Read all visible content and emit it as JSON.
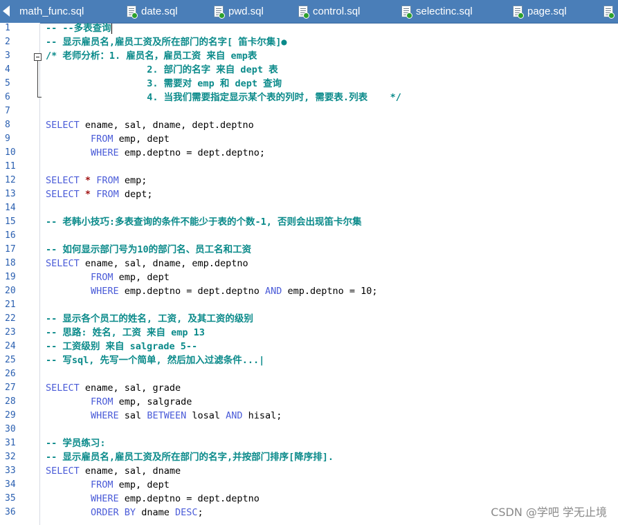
{
  "tabs": [
    {
      "label": "math_func.sql"
    },
    {
      "label": "date.sql"
    },
    {
      "label": "pwd.sql"
    },
    {
      "label": "control.sql"
    },
    {
      "label": "selectinc.sql"
    },
    {
      "label": "page.sql"
    }
  ],
  "editor": {
    "lines": [
      {
        "n": "1",
        "parts": [
          [
            "c",
            "-- --多表查询"
          ]
        ]
      },
      {
        "n": "2",
        "parts": [
          [
            "c",
            "-- 显示雇员名,雇员工资及所在部门的名字[ 笛卡尔集]●"
          ]
        ]
      },
      {
        "n": "3",
        "parts": [
          [
            "c",
            "/* 老师分析：1. 雇员名，雇员工资 来自 emp表"
          ]
        ]
      },
      {
        "n": "4",
        "parts": [
          [
            "c",
            "                  2. 部门的名字 来自 dept 表"
          ]
        ]
      },
      {
        "n": "5",
        "parts": [
          [
            "c",
            "                  3. 需要对 emp 和 dept 查询"
          ]
        ]
      },
      {
        "n": "6",
        "parts": [
          [
            "c",
            "                  4. 当我们需要指定显示某个表的列时, 需要表.列表    */"
          ]
        ]
      },
      {
        "n": "7",
        "parts": []
      },
      {
        "n": "8",
        "parts": [
          [
            "k",
            "SELECT"
          ],
          [
            "t",
            " ename, sal, dname, dept.deptno"
          ]
        ]
      },
      {
        "n": "9",
        "parts": [
          [
            "t",
            "        "
          ],
          [
            "k",
            "FROM"
          ],
          [
            "t",
            " emp, dept"
          ]
        ]
      },
      {
        "n": "10",
        "parts": [
          [
            "t",
            "        "
          ],
          [
            "k",
            "WHERE"
          ],
          [
            "t",
            " emp.deptno = dept.deptno;"
          ]
        ]
      },
      {
        "n": "11",
        "parts": []
      },
      {
        "n": "12",
        "parts": [
          [
            "k",
            "SELECT"
          ],
          [
            "t",
            " "
          ],
          [
            "o",
            "*"
          ],
          [
            "t",
            " "
          ],
          [
            "k",
            "FROM"
          ],
          [
            "t",
            " emp;"
          ]
        ]
      },
      {
        "n": "13",
        "parts": [
          [
            "k",
            "SELECT"
          ],
          [
            "t",
            " "
          ],
          [
            "o",
            "*"
          ],
          [
            "t",
            " "
          ],
          [
            "k",
            "FROM"
          ],
          [
            "t",
            " dept;"
          ]
        ]
      },
      {
        "n": "14",
        "parts": []
      },
      {
        "n": "15",
        "parts": [
          [
            "c",
            "-- 老韩小技巧:多表查询的条件不能少于表的个数-1, 否则会出现笛卡尔集"
          ]
        ]
      },
      {
        "n": "16",
        "parts": []
      },
      {
        "n": "17",
        "parts": [
          [
            "c",
            "-- 如何显示部门号为10的部门名、员工名和工资"
          ]
        ]
      },
      {
        "n": "18",
        "parts": [
          [
            "k",
            "SELECT"
          ],
          [
            "t",
            " ename, sal, dname, emp.deptno"
          ]
        ]
      },
      {
        "n": "19",
        "parts": [
          [
            "t",
            "        "
          ],
          [
            "k",
            "FROM"
          ],
          [
            "t",
            " emp, dept"
          ]
        ]
      },
      {
        "n": "20",
        "parts": [
          [
            "t",
            "        "
          ],
          [
            "k",
            "WHERE"
          ],
          [
            "t",
            " emp.deptno = dept.deptno "
          ],
          [
            "k",
            "AND"
          ],
          [
            "t",
            " emp.deptno = 10;"
          ]
        ]
      },
      {
        "n": "21",
        "parts": []
      },
      {
        "n": "22",
        "parts": [
          [
            "c",
            "-- 显示各个员工的姓名, 工资, 及其工资的级别"
          ]
        ]
      },
      {
        "n": "23",
        "parts": [
          [
            "c",
            "-- 思路: 姓名, 工资 来自 emp 13"
          ]
        ]
      },
      {
        "n": "24",
        "parts": [
          [
            "c",
            "-- 工资级别 来自 salgrade 5--"
          ]
        ]
      },
      {
        "n": "25",
        "parts": [
          [
            "c",
            "-- 写sql, 先写一个简单, 然后加入过滤条件...|"
          ]
        ]
      },
      {
        "n": "26",
        "parts": []
      },
      {
        "n": "27",
        "parts": [
          [
            "k",
            "SELECT"
          ],
          [
            "t",
            " ename, sal, grade"
          ]
        ]
      },
      {
        "n": "28",
        "parts": [
          [
            "t",
            "        "
          ],
          [
            "k",
            "FROM"
          ],
          [
            "t",
            " emp, salgrade"
          ]
        ]
      },
      {
        "n": "29",
        "parts": [
          [
            "t",
            "        "
          ],
          [
            "k",
            "WHERE"
          ],
          [
            "t",
            " sal "
          ],
          [
            "k",
            "BETWEEN"
          ],
          [
            "t",
            " losal "
          ],
          [
            "k",
            "AND"
          ],
          [
            "t",
            " hisal;"
          ]
        ]
      },
      {
        "n": "30",
        "parts": []
      },
      {
        "n": "31",
        "parts": [
          [
            "c",
            "-- 学员练习:"
          ]
        ]
      },
      {
        "n": "32",
        "parts": [
          [
            "c",
            "-- 显示雇员名,雇员工资及所在部门的名字,并按部门排序[降序排]."
          ]
        ]
      },
      {
        "n": "33",
        "parts": [
          [
            "k",
            "SELECT"
          ],
          [
            "t",
            " ename, sal, dname"
          ]
        ]
      },
      {
        "n": "34",
        "parts": [
          [
            "t",
            "        "
          ],
          [
            "k",
            "FROM"
          ],
          [
            "t",
            " emp, dept"
          ]
        ]
      },
      {
        "n": "35",
        "parts": [
          [
            "t",
            "        "
          ],
          [
            "k",
            "WHERE"
          ],
          [
            "t",
            " emp.deptno = dept.deptno"
          ]
        ]
      },
      {
        "n": "36",
        "parts": [
          [
            "t",
            "        "
          ],
          [
            "k",
            "ORDER BY"
          ],
          [
            "t",
            " dname "
          ],
          [
            "k",
            "DESC"
          ],
          [
            "t",
            ";"
          ]
        ]
      }
    ]
  },
  "watermark": "CSDN @学吧 学无止境",
  "colors": {
    "tab_bar": "#4a7eb8",
    "comment": "#0a8a8a",
    "keyword": "#4a5bd8",
    "line_number": "#2a5fb0"
  },
  "icons": {
    "tab_scroll": "left-arrow-icon",
    "tab_file": "sql-file-icon"
  }
}
